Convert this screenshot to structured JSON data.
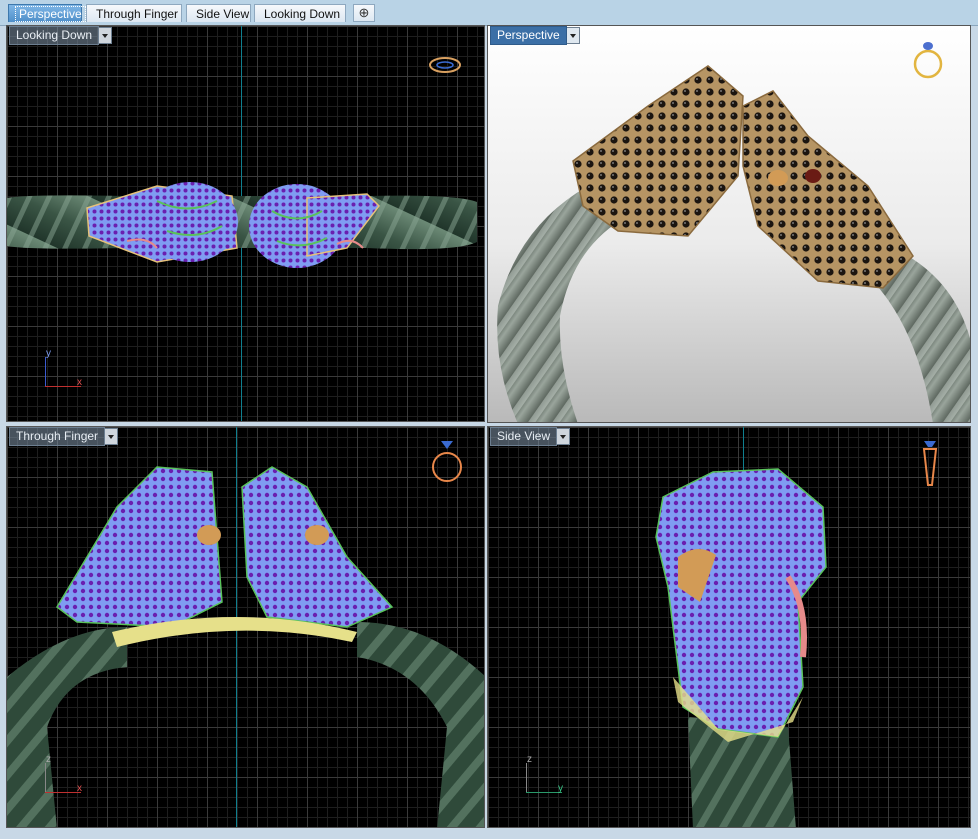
{
  "tabs": [
    {
      "label": "Perspective",
      "active": true
    },
    {
      "label": "Through Finger",
      "active": false
    },
    {
      "label": "Side View",
      "active": false
    },
    {
      "label": "Looking Down",
      "active": false
    }
  ],
  "add_tab_symbol": "⊕",
  "viewports": {
    "top_left": {
      "label": "Looking Down",
      "axis_a": "y",
      "axis_b": "x"
    },
    "top_right": {
      "label": "Perspective"
    },
    "bottom_left": {
      "label": "Through Finger",
      "axis_a": "z",
      "axis_b": "x"
    },
    "bottom_right": {
      "label": "Side View",
      "axis_a": "z",
      "axis_b": "y"
    }
  },
  "icons": {
    "top_left": "ring-top-view-icon",
    "top_right": "ring-perspective-icon",
    "bottom_left": "ring-front-view-icon",
    "bottom_right": "ring-side-view-icon"
  },
  "colors": {
    "band": "#3f5a4a",
    "metal": "#b08a55",
    "gem_blue": "#6f8fe8",
    "gem_purple": "#7a2bb8",
    "active_tab": "#4f8fc9"
  }
}
